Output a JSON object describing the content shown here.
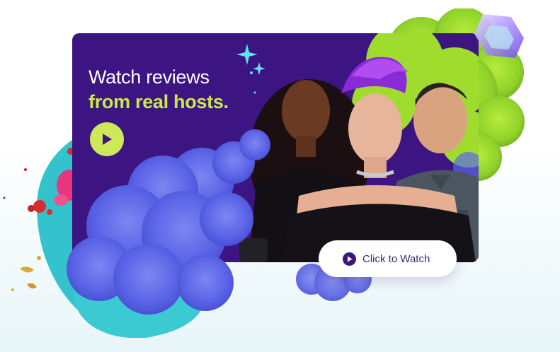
{
  "hero": {
    "headline_line1": "Watch reviews",
    "headline_line2": "from real hosts.",
    "cta_label": "Click to Watch"
  },
  "colors": {
    "card_purple": "#3d1582",
    "accent_lime": "#c9ea46",
    "play_lime": "#cfe85a",
    "teal": "#34c3cc",
    "smoke_blue": "#5a63e6",
    "smoke_green": "#9fdc2e",
    "pill_text": "#3a2a6a"
  },
  "icons": {
    "hero_play": "play-icon",
    "cta_play": "play-icon",
    "sparkle": "sparkle-icon",
    "ring": "hexagon-ring-icon"
  }
}
